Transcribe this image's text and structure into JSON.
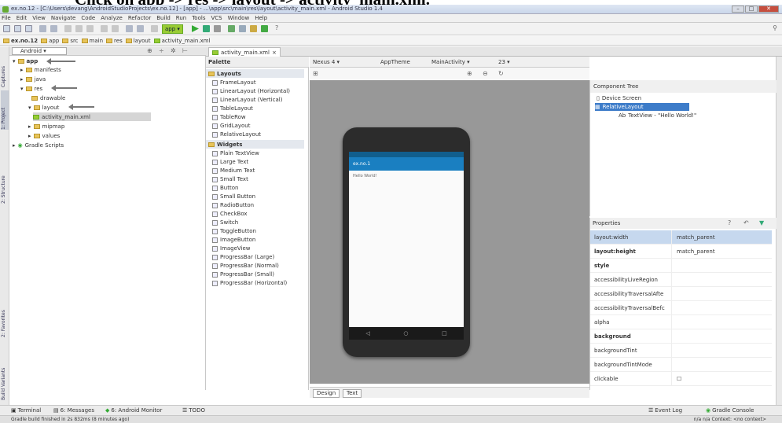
{
  "caption": "Click  on app -> res -> layout -> activity_main.xml.",
  "window": {
    "title": "ex.no.12 - [C:\\Users\\devang\\AndroidStudioProjects\\ex.no.12] - [app] - ...\\app\\src\\main\\res\\layout\\activity_main.xml - Android Studio 1.4"
  },
  "menu": [
    "File",
    "Edit",
    "View",
    "Navigate",
    "Code",
    "Analyze",
    "Refactor",
    "Build",
    "Run",
    "Tools",
    "VCS",
    "Window",
    "Help"
  ],
  "toolbar": {
    "run_config": "app"
  },
  "breadcrumbs": [
    "ex.no.12",
    "app",
    "src",
    "main",
    "res",
    "layout",
    "activity_main.xml"
  ],
  "project": {
    "view_selector": "Android",
    "tree": [
      {
        "label": "app",
        "level": 0
      },
      {
        "label": "manifests",
        "level": 1
      },
      {
        "label": "java",
        "level": 1
      },
      {
        "label": "res",
        "level": 1
      },
      {
        "label": "drawable",
        "level": 2
      },
      {
        "label": "layout",
        "level": 2
      },
      {
        "label": "activity_main.xml",
        "level": 3
      },
      {
        "label": "mipmap",
        "level": 2
      },
      {
        "label": "values",
        "level": 2
      },
      {
        "label": "Gradle Scripts",
        "level": 0
      }
    ]
  },
  "left_tool_tabs": [
    "1: Project",
    "2: Structure",
    "Captures",
    "2: Favorites",
    "Build Variants"
  ],
  "editor": {
    "tab": "activity_main.xml"
  },
  "palette": {
    "title": "Palette",
    "layouts_label": "Layouts",
    "layouts": [
      "FrameLayout",
      "LinearLayout (Horizontal)",
      "LinearLayout (Vertical)",
      "TableLayout",
      "TableRow",
      "GridLayout",
      "RelativeLayout"
    ],
    "widgets_label": "Widgets",
    "widgets": [
      "Plain TextView",
      "Large Text",
      "Medium Text",
      "Small Text",
      "Button",
      "Small Button",
      "RadioButton",
      "CheckBox",
      "Switch",
      "ToggleButton",
      "ImageButton",
      "ImageView",
      "ProgressBar (Large)",
      "ProgressBar (Normal)",
      "ProgressBar (Small)",
      "ProgressBar (Horizontal)"
    ]
  },
  "design_toolbar": {
    "device": "Nexus 4",
    "theme": "AppTheme",
    "activity": "MainActivity",
    "api": "23"
  },
  "phone": {
    "app_title": "ex.no.1",
    "hello_text": "Hello World!"
  },
  "bottom_design_tabs": [
    "Design",
    "Text"
  ],
  "component_tree": {
    "title": "Component Tree",
    "items": [
      {
        "label": "Device Screen",
        "level": 0
      },
      {
        "label": "RelativeLayout",
        "level": 1
      },
      {
        "label": "TextView - \"Hello World!\"",
        "level": 2
      }
    ]
  },
  "properties": {
    "title": "Properties",
    "rows": [
      {
        "key": "layout:width",
        "value": "match_parent"
      },
      {
        "key": "layout:height",
        "value": "match_parent"
      },
      {
        "key": "style",
        "value": ""
      },
      {
        "key": "accessibilityLiveRegion",
        "value": ""
      },
      {
        "key": "accessibilityTraversalAfte",
        "value": ""
      },
      {
        "key": "accessibilityTraversalBefc",
        "value": ""
      },
      {
        "key": "alpha",
        "value": ""
      },
      {
        "key": "background",
        "value": ""
      },
      {
        "key": "backgroundTint",
        "value": ""
      },
      {
        "key": "backgroundTintMode",
        "value": ""
      },
      {
        "key": "clickable",
        "value": ""
      }
    ]
  },
  "bottom_tools": [
    "Terminal",
    "6: Messages",
    "6: Android Monitor",
    "TODO",
    "Event Log",
    "Gradle Console"
  ],
  "status": {
    "message": "Gradle build finished in 2s 832ms (8 minutes ago)",
    "right": "n/a   n/a   Context: <no context>"
  }
}
